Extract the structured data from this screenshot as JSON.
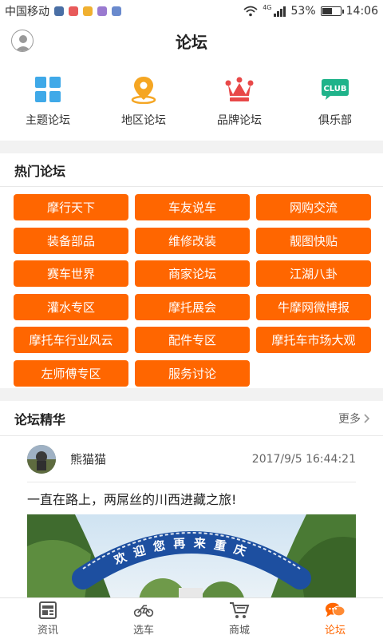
{
  "status_bar": {
    "carrier": "中国移动",
    "network": "4G",
    "battery": "53%",
    "battery_fraction": 0.53,
    "time": "14:06"
  },
  "header": {
    "title": "论坛"
  },
  "categories": [
    {
      "label": "主题论坛",
      "icon": "grid-icon",
      "color": "#3fa9e8"
    },
    {
      "label": "地区论坛",
      "icon": "location-pin-icon",
      "color": "#f5a623"
    },
    {
      "label": "品牌论坛",
      "icon": "crown-icon",
      "color": "#e84848"
    },
    {
      "label": "俱乐部",
      "icon": "club-badge-icon",
      "color": "#1fb38a",
      "badge_text": "CLUB"
    }
  ],
  "hot": {
    "title": "热门论坛",
    "tags": [
      "摩行天下",
      "车友说车",
      "网购交流",
      "装备部品",
      "维修改装",
      "靓图快贴",
      "赛车世界",
      "商家论坛",
      "江湖八卦",
      "灌水专区",
      "摩托展会",
      "牛摩网微博报",
      "摩托车行业风云",
      "配件专区",
      "摩托车市场大观",
      "左师傅专区",
      "服务讨论"
    ]
  },
  "essence": {
    "title": "论坛精华",
    "more": "更多",
    "post": {
      "user": "熊猫猫",
      "time": "2017/9/5 16:44:21",
      "title": "一直在路上，两屌丝的川西进藏之旅!",
      "image_banner": "欢迎您再来重庆"
    }
  },
  "tabs": [
    {
      "label": "资讯",
      "icon": "news-icon",
      "active": false
    },
    {
      "label": "选车",
      "icon": "motorcycle-icon",
      "active": false
    },
    {
      "label": "商城",
      "icon": "cart-icon",
      "active": false
    },
    {
      "label": "论坛",
      "icon": "chat-bubbles-icon",
      "active": true
    }
  ],
  "colors": {
    "accent": "#ff6600",
    "background": "#f2f2f2"
  }
}
